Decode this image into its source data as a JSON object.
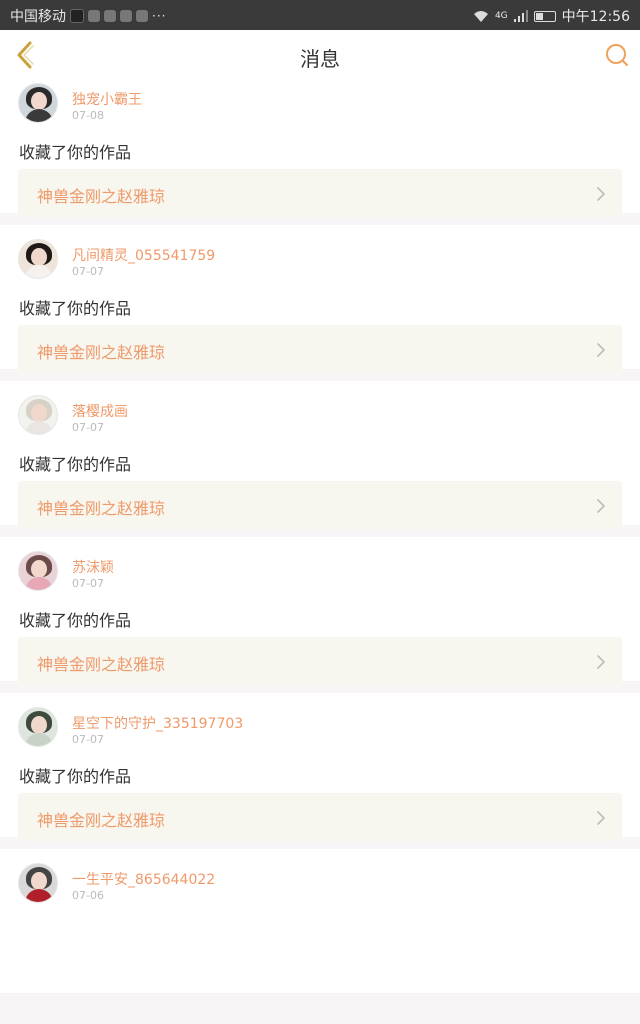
{
  "status_bar": {
    "carrier": "中国移动",
    "more": "···",
    "network": "4G",
    "time": "中午12:56",
    "battery_level": 0.45
  },
  "header": {
    "title": "消息",
    "back_icon": "chevron-left-icon",
    "search_icon": "search-icon",
    "accent": "#c8a23a"
  },
  "colors": {
    "username": "#ef9a6a",
    "work_title": "#ef9a6a",
    "action": "#333333",
    "date": "#bbbbbb",
    "work_bg": "#f7f6ef"
  },
  "messages": [
    {
      "username": "独宠小霸王",
      "date": "07-08",
      "action": "收藏了你的作品",
      "work": "神兽金刚之赵雅琼"
    },
    {
      "username": "凡间精灵_055541759",
      "date": "07-07",
      "action": "收藏了你的作品",
      "work": "神兽金刚之赵雅琼"
    },
    {
      "username": "落樱成画",
      "date": "07-07",
      "action": "收藏了你的作品",
      "work": "神兽金刚之赵雅琼"
    },
    {
      "username": "苏沫颖",
      "date": "07-07",
      "action": "收藏了你的作品",
      "work": "神兽金刚之赵雅琼"
    },
    {
      "username": "星空下的守护_335197703",
      "date": "07-07",
      "action": "收藏了你的作品",
      "work": "神兽金刚之赵雅琼"
    },
    {
      "username": "一生平安_865644022",
      "date": "07-06",
      "action": "",
      "work": ""
    }
  ]
}
